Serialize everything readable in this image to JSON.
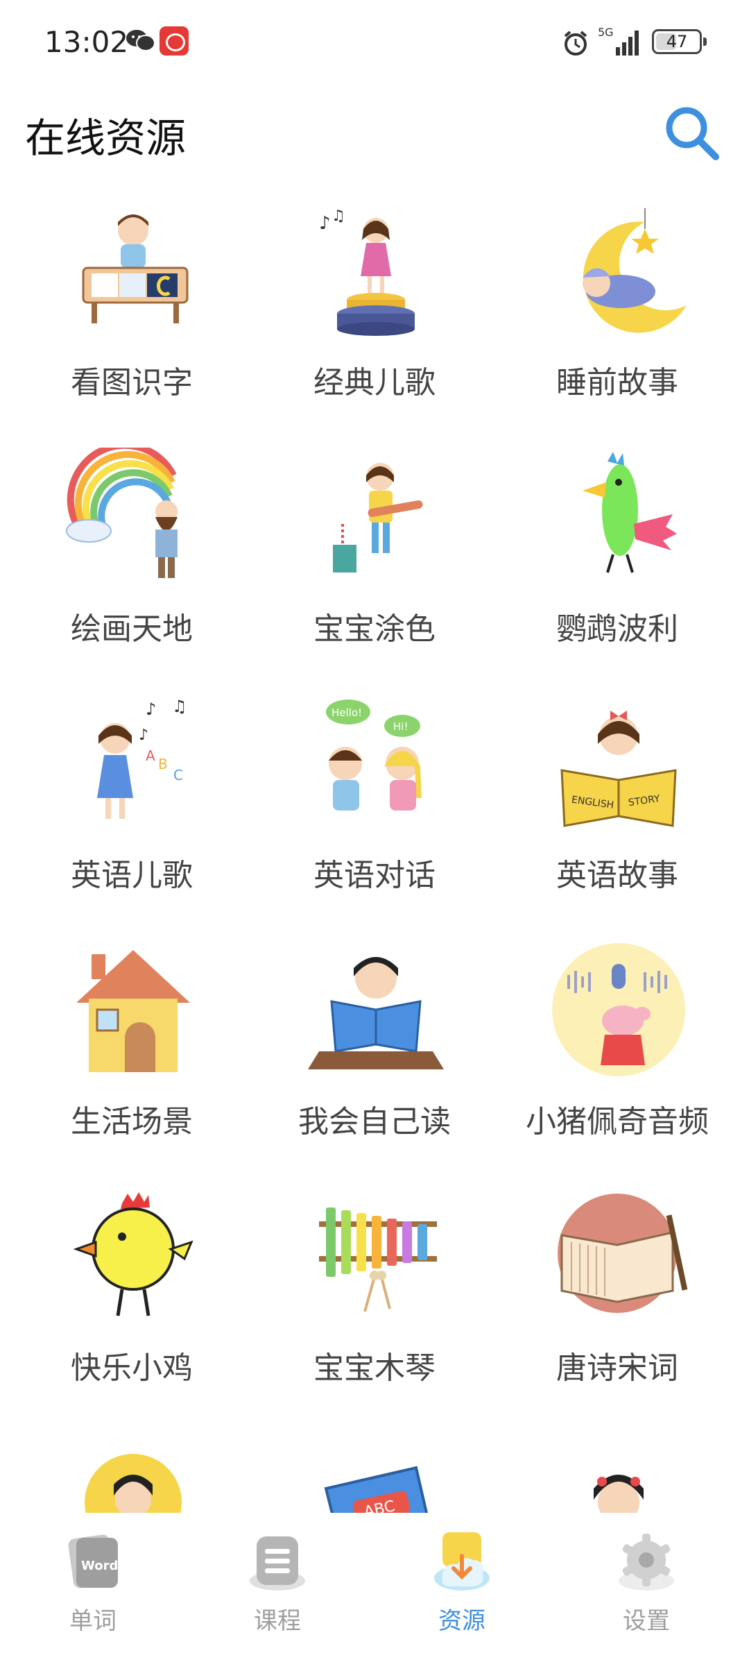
{
  "status_bar": {
    "time": "13:02",
    "network": "5G",
    "battery": "47",
    "battery_level": 0.47
  },
  "header": {
    "title": "在线资源"
  },
  "resources": [
    {
      "label": "看图识字",
      "icon": "picture-literacy-icon"
    },
    {
      "label": "经典儿歌",
      "icon": "classic-songs-icon"
    },
    {
      "label": "睡前故事",
      "icon": "bedtime-story-icon"
    },
    {
      "label": "绘画天地",
      "icon": "painting-world-icon"
    },
    {
      "label": "宝宝涂色",
      "icon": "baby-coloring-icon"
    },
    {
      "label": "鹦鹉波利",
      "icon": "parrot-polly-icon"
    },
    {
      "label": "英语儿歌",
      "icon": "english-songs-icon"
    },
    {
      "label": "英语对话",
      "icon": "english-dialogue-icon"
    },
    {
      "label": "英语故事",
      "icon": "english-story-icon"
    },
    {
      "label": "生活场景",
      "icon": "life-scene-icon"
    },
    {
      "label": "我会自己读",
      "icon": "self-reading-icon"
    },
    {
      "label": "小猪佩奇音频",
      "icon": "peppa-audio-icon"
    },
    {
      "label": "快乐小鸡",
      "icon": "happy-chick-icon"
    },
    {
      "label": "宝宝木琴",
      "icon": "baby-xylophone-icon"
    },
    {
      "label": "唐诗宋词",
      "icon": "tang-poetry-icon"
    },
    {
      "label": "",
      "icon": "ancient-scholar-icon"
    },
    {
      "label": "",
      "icon": "abc-book-icon"
    },
    {
      "label": "",
      "icon": "opera-girl-icon"
    }
  ],
  "illustration_text": {
    "hello": "Hello!",
    "hi": "Hi!",
    "english": "ENGLISH",
    "story": "STORY",
    "abc": "ABC"
  },
  "bottom_nav": [
    {
      "label": "单词",
      "icon": "word-card-icon",
      "badge_text": "Word",
      "active": false
    },
    {
      "label": "课程",
      "icon": "course-list-icon",
      "active": false
    },
    {
      "label": "资源",
      "icon": "resource-download-icon",
      "active": true
    },
    {
      "label": "设置",
      "icon": "settings-gear-icon",
      "active": false
    }
  ],
  "colors": {
    "accent": "#3d8fe0",
    "nav_inactive": "#9e9e9e",
    "label_text": "#444444"
  }
}
